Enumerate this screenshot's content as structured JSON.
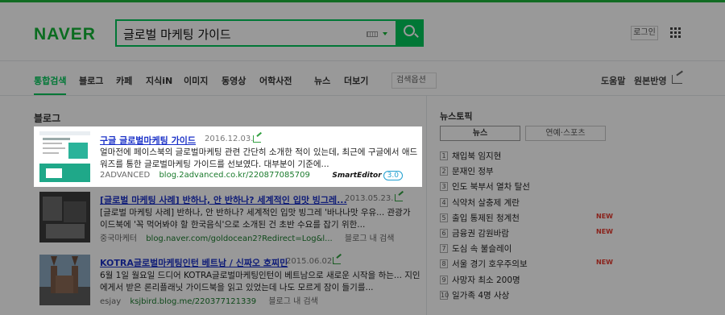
{
  "brand": {
    "logo": "NAVER",
    "accent": "#03c75a",
    "logo_color": "#13b536"
  },
  "search": {
    "query": "글로벌 마케팅 가이드",
    "keyboard_icon": "keyboard-icon",
    "button_icon": "search-icon"
  },
  "header": {
    "login_label": "로그인",
    "menu_icon": "grid-menu-icon"
  },
  "nav": {
    "tabs": [
      {
        "label": "통합검색"
      },
      {
        "label": "블로그"
      },
      {
        "label": "카페"
      },
      {
        "label": "지식iN"
      },
      {
        "label": "이미지"
      },
      {
        "label": "동영상"
      },
      {
        "label": "어학사전"
      },
      {
        "label": "뉴스"
      },
      {
        "label": "더보기"
      }
    ],
    "search_options": "검색옵션",
    "help": "도움말",
    "source_view": "원본반영"
  },
  "blog": {
    "section_title": "블로그",
    "results": [
      {
        "title": "구글 글로벌마케팅 가이드",
        "date": "2016.12.03.",
        "desc_line1": "얼마전에 페이스북의 글로벌마케팅 관련 간단히 소개한 적이 있는데, 최근에 구글에서 애드",
        "desc_line2": "워즈를 통한 글로벌마케팅 가이드를 선보였다. 대부분이 기준에...",
        "author": "2ADVANCED",
        "url": "blog.2advanced.co.kr/220877085709",
        "badge_name": "SmartEditor",
        "badge_version": "3.0"
      },
      {
        "title": "[글로벌 마케팅 사례] 반하나, 안 반하나? 세계적인 입맛 빙그레...",
        "date": "2013.05.23.",
        "desc_line1": "[글로벌 마케팅 사례] 반하나, 안 반하나? 세계적인 입맛 빙그레 '바나나맛 우유... 관광가",
        "desc_line2": "이드북에 '꼭 먹어봐야 할 한국음식'으로 소개된 건 초반 수요를 잡기 위한...",
        "author": "중국마케터",
        "url": "blog.naver.com/goldocean2?Redirect=Log&l...",
        "extra": "블로그 내 검색"
      },
      {
        "title": "KOTRA글로벌마케팅인턴 베트남 / 신짜오 호찌민",
        "date": "2015.06.02.",
        "desc_line1": "6월 1일 월요일 드디어 KOTRA글로벌마케팅인턴이 베트남으로 새로운 시작을 하는... 지인",
        "desc_line2": "에게서 받은 론리플래닛 가이드북을 읽고 있었는데 나도 모르게 잠이 들기를...",
        "author": "esjay",
        "url": "ksjbird.blog.me/220377121339",
        "extra": "블로그 내 검색"
      }
    ]
  },
  "news_topics": {
    "title": "뉴스토픽",
    "tabs": [
      "뉴스",
      "연예·스포츠"
    ],
    "items": [
      {
        "rank": "1",
        "text": "채입북 임지현",
        "new": ""
      },
      {
        "rank": "2",
        "text": "문재인 정부",
        "new": ""
      },
      {
        "rank": "3",
        "text": "인도 북부서 열차 탈선",
        "new": ""
      },
      {
        "rank": "4",
        "text": "식약처 살충제 계란",
        "new": ""
      },
      {
        "rank": "5",
        "text": "출입 통제된 청계천",
        "new": "NEW"
      },
      {
        "rank": "6",
        "text": "금융권 감원바람",
        "new": "NEW"
      },
      {
        "rank": "7",
        "text": "도심 속 불슬레이",
        "new": ""
      },
      {
        "rank": "8",
        "text": "서울 경기 호우주의보",
        "new": "NEW"
      },
      {
        "rank": "9",
        "text": "사망자 최소 200명",
        "new": ""
      },
      {
        "rank": "10",
        "text": "일가족 4명 사상",
        "new": ""
      }
    ]
  }
}
